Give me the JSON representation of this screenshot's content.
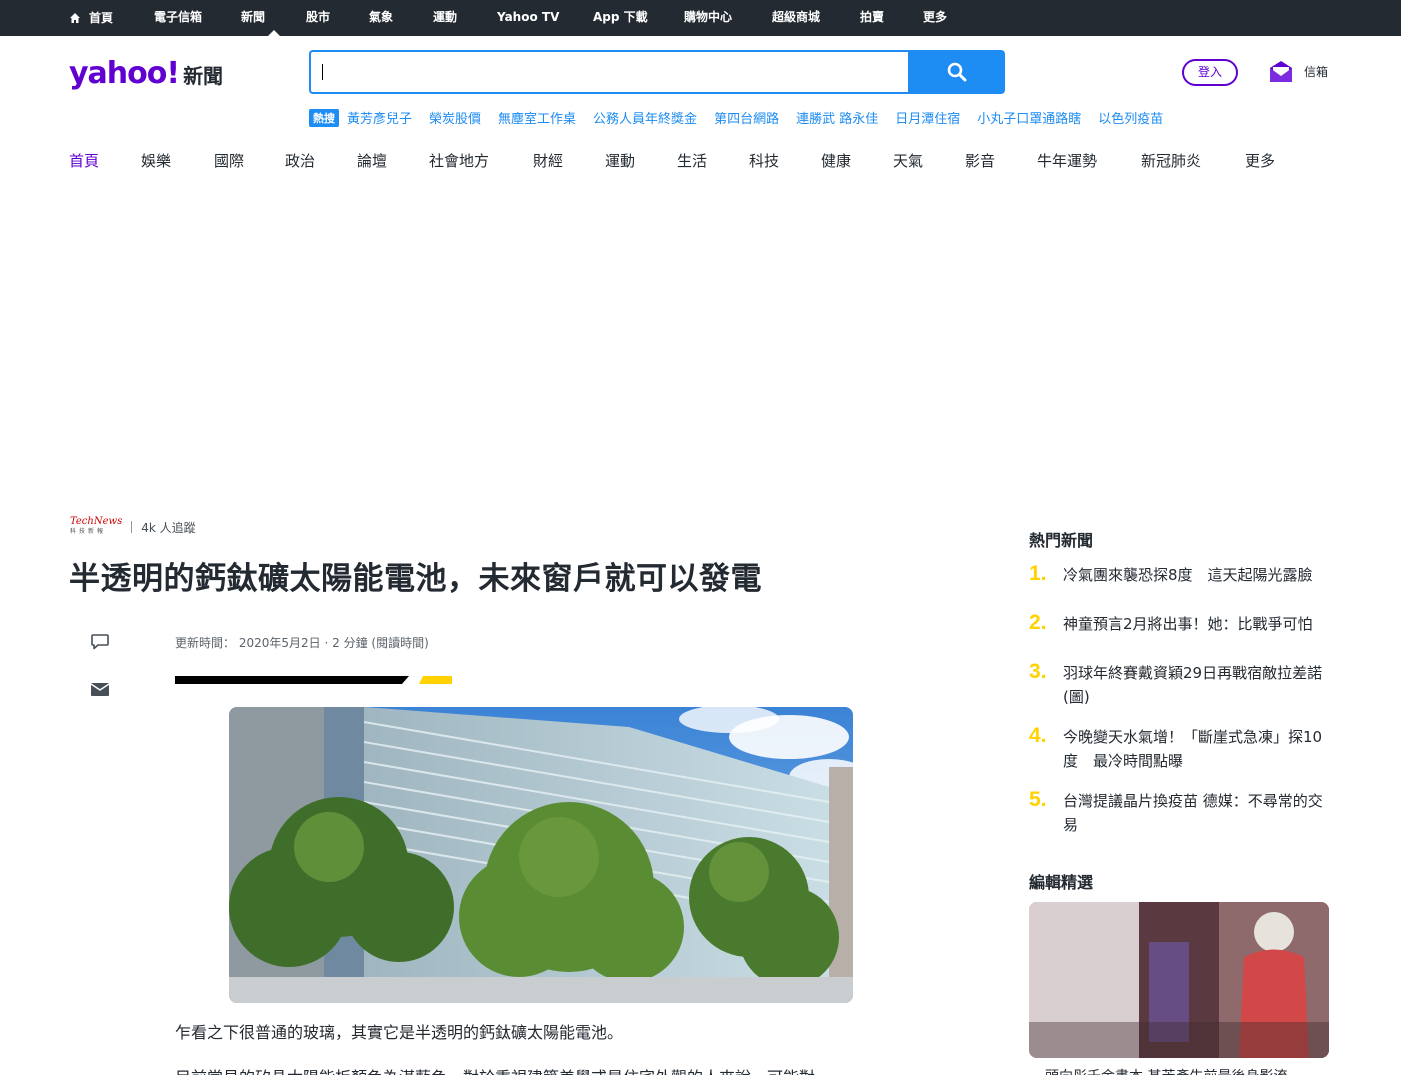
{
  "topbar": {
    "items": [
      "首頁",
      "電子信箱",
      "新聞",
      "股市",
      "氣象",
      "運動",
      "Yahoo TV",
      "App 下載",
      "購物中心",
      "超級商城",
      "拍賣",
      "更多"
    ]
  },
  "header": {
    "logo_text": "yahoo!",
    "section": "新聞",
    "search_placeholder": "",
    "login_label": "登入",
    "mail_label": "信箱"
  },
  "trending": {
    "badge": "熱搜",
    "items": [
      "黃芳彥兒子",
      "榮炭股價",
      "無塵室工作桌",
      "公務人員年終獎金",
      "第四台網路",
      "連勝武 路永佳",
      "日月潭住宿",
      "小丸子口罩通路瞎",
      "以色列疫苗"
    ]
  },
  "nav": {
    "items": [
      "首頁",
      "娛樂",
      "國際",
      "政治",
      "論壇",
      "社會地方",
      "財經",
      "運動",
      "生活",
      "科技",
      "健康",
      "天氣",
      "影音",
      "牛年運勢",
      "新冠肺炎",
      "更多"
    ]
  },
  "article": {
    "publisher_logo": "TechNews",
    "publisher_sub": "科技新報",
    "followers": "4k 人追蹤",
    "headline": "半透明的鈣鈦礦太陽能電池，未來窗戶就可以發電",
    "meta_label": "更新時間：",
    "date": "2020年5月2日",
    "read_time": "2 分鐘 (閱讀時間)",
    "para1": "乍看之下很普通的玻璃，其實它是半透明的鈣鈦礦太陽能電池。",
    "para2": "目前常見的矽晶太陽能板顏色為湛藍色，對於重視建築美學或是住宅外觀的人來說，可能對"
  },
  "sidebar": {
    "hot_title": "熱門新聞",
    "hot": [
      {
        "num": "1.",
        "text": "冷氣團來襲恐探8度　這天起陽光露臉"
      },
      {
        "num": "2.",
        "text": "神童預言2月將出事！她：比戰爭可怕"
      },
      {
        "num": "3.",
        "text": "羽球年終賽戴資穎29日再戰宿敵拉差諾 (圖)"
      },
      {
        "num": "4.",
        "text": "今晚變天水氣增！「斷崖式急凍」探10度　最冷時間點曝"
      },
      {
        "num": "5.",
        "text": "台灣提議晶片換疫苗 德媒：不尋常的交易"
      }
    ],
    "editor_title": "編輯精選",
    "editor_caption": "頭向彤千金書本 甚芳彥生前最後身影流"
  },
  "colors": {
    "topbar_bg": "#232a31",
    "brand": "#6001d2",
    "search_blue": "#1d8cf3",
    "rank_yellow": "#ffd200"
  }
}
